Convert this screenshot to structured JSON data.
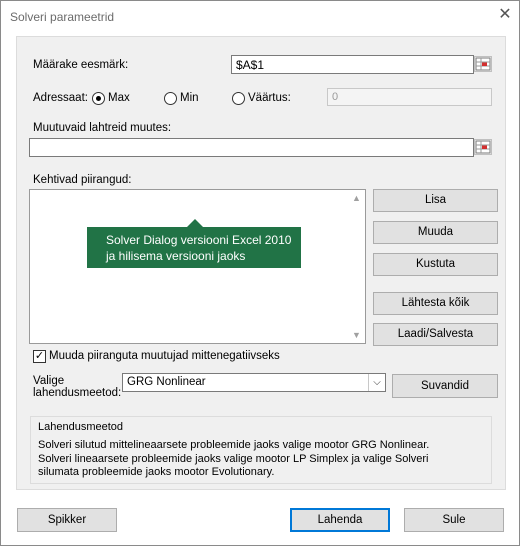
{
  "window": {
    "title": "Solveri parameetrid",
    "close_glyph": "✕"
  },
  "objective": {
    "label": "Määrake eesmärk:",
    "value": "$A$1"
  },
  "to": {
    "label": "Adressaat:",
    "options": [
      {
        "label": "Max",
        "selected": true
      },
      {
        "label": "Min",
        "selected": false
      },
      {
        "label": "Väärtus:",
        "selected": false
      }
    ],
    "value": "0"
  },
  "changing": {
    "label": "Muutuvaid lahtreid muutes:",
    "value": ""
  },
  "constraints": {
    "label": "Kehtivad piirangud:",
    "items": []
  },
  "tooltip": {
    "line1": "Solver Dialog versiooni Excel 2010",
    "line2": "ja hilisema versiooni jaoks"
  },
  "constraint_buttons": {
    "add": "Lisa",
    "change": "Muuda",
    "delete": "Kustuta",
    "reset": "Lähtesta kõik",
    "load_save": "Laadi/Salvesta"
  },
  "nonnegative": {
    "label": "Muuda piiranguta muutujad mittenegatiivseks",
    "checked": true
  },
  "method": {
    "label_line1": "Valige",
    "label_line2": "lahendusmeetod:",
    "value": "GRG Nonlinear",
    "options_button": "Suvandid"
  },
  "solving_method": {
    "title": "Lahendusmeetod",
    "line1": "Solveri silutud mittelineaarsete probleemide jaoks valige mootor GRG Nonlinear.",
    "line2": "Solveri lineaarsete probleemide jaoks valige mootor LP Simplex ja valige Solveri",
    "line3": "silumata probleemide jaoks mootor Evolutionary."
  },
  "footer": {
    "help": "Spikker",
    "solve": "Lahenda",
    "close": "Sule"
  },
  "colors": {
    "tooltip_bg": "#217346",
    "default_button_border": "#0078d7"
  },
  "icons": {
    "range_select": "range-select-icon",
    "close": "close-icon",
    "check": "checkmark-icon",
    "dropdown": "chevron-down-icon"
  }
}
